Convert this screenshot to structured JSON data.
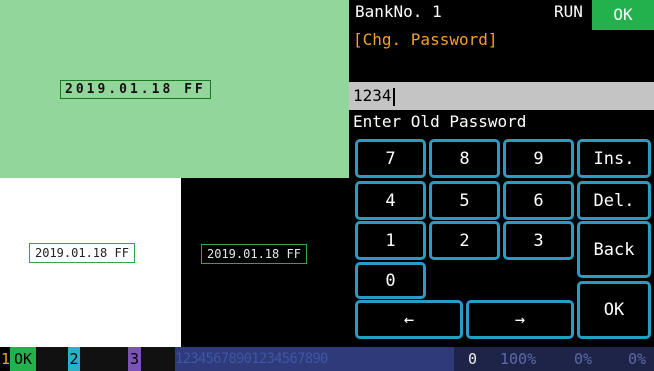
{
  "preview": {
    "date_pixel": "2019.01.18 FF",
    "date_white": "2019.01.18 FF",
    "date_black": "2019.01.18 FF"
  },
  "panel": {
    "bank": "BankNo. 1",
    "run": "RUN",
    "ok_badge": "OK",
    "mode": "[Chg. Password]",
    "input_value": "1234",
    "prompt": "Enter Old Password"
  },
  "keypad": {
    "k7": "7",
    "k8": "8",
    "k9": "9",
    "ins": "Ins.",
    "k4": "4",
    "k5": "5",
    "k6": "6",
    "del": "Del.",
    "k1": "1",
    "k2": "2",
    "k3": "3",
    "back": "Back",
    "k0": "0",
    "left": "←",
    "right": "→",
    "ok": "OK"
  },
  "status": {
    "ch1_num": "1",
    "ch1_text": "OK",
    "ch2_num": "2",
    "ch3_num": "3",
    "digits": "12345678901234567890",
    "zero": "0",
    "pct1": "100%",
    "pct2": "0%",
    "pct3": "0%"
  },
  "colors": {
    "green_pane": "#93d69b",
    "key_border": "#2a9bc4",
    "ok_badge": "#23b14d",
    "mode_text": "#f1a12a"
  }
}
